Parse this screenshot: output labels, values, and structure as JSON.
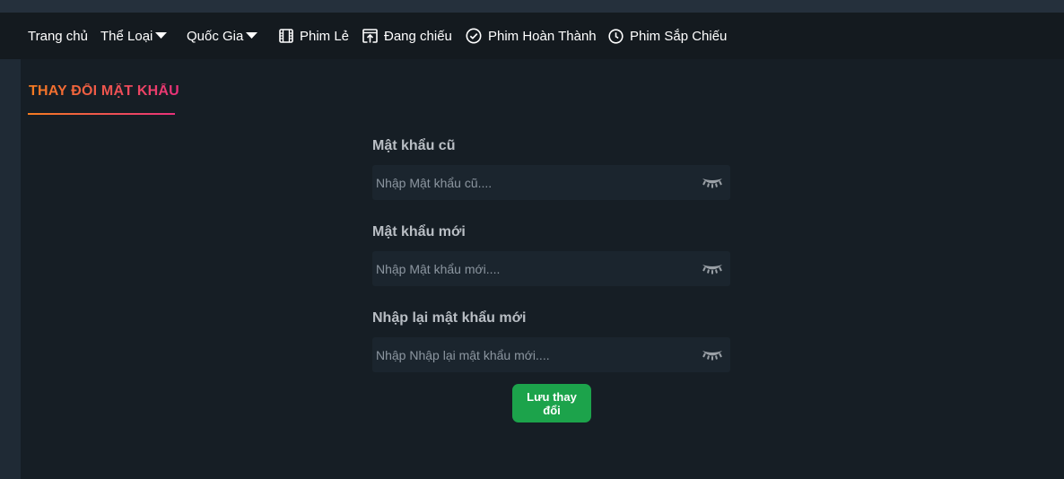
{
  "nav": {
    "items": [
      {
        "label": "Trang chủ",
        "icon": ""
      },
      {
        "label": "Thể Loại",
        "icon": "caret-down-icon"
      },
      {
        "label": "Quốc Gia",
        "icon": "caret-down-icon"
      },
      {
        "label": "Phim Lẻ",
        "icon": "film-icon"
      },
      {
        "label": "Đang chiếu",
        "icon": "upload-box-icon"
      },
      {
        "label": "Phim Hoàn Thành",
        "icon": "check-circle-icon"
      },
      {
        "label": "Phim Sắp Chiếu",
        "icon": "clock-icon"
      }
    ]
  },
  "page": {
    "title": "THAY ĐỔI MẬT KHẨU"
  },
  "form": {
    "old_password": {
      "label": "Mật khẩu cũ",
      "placeholder": "Nhập Mật khẩu cũ....",
      "value": ""
    },
    "new_password": {
      "label": "Mật khẩu mới",
      "placeholder": "Nhập Mật khẩu mới....",
      "value": ""
    },
    "confirm_password": {
      "label": "Nhập lại mật khẩu mới",
      "placeholder": "Nhập Nhập lại mật khẩu mới....",
      "value": ""
    },
    "toggle_icon": "eye-closed-icon",
    "save_label": "Lưu thay đổi"
  },
  "colors": {
    "accent_gradient_start": "#f57c20",
    "accent_gradient_end": "#e9317b",
    "save_button": "#1ca34b",
    "navbar_bg": "#141a1f",
    "main_bg": "#161e25"
  }
}
